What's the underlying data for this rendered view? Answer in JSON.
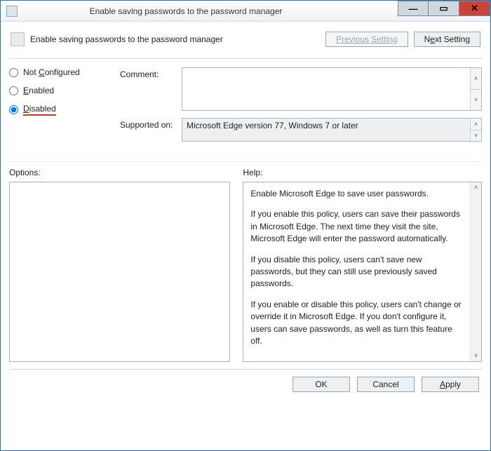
{
  "window": {
    "title": "Enable saving passwords to the password manager"
  },
  "header": {
    "title": "Enable saving passwords to the password manager",
    "prev_btn": "Previous Setting",
    "next_btn_pre": "N",
    "next_btn_u": "e",
    "next_btn_post": "xt Setting"
  },
  "state": {
    "not_configured_pre": "Not ",
    "not_configured_u": "C",
    "not_configured_post": "onfigured",
    "enabled_u": "E",
    "enabled_post": "nabled",
    "disabled_u": "D",
    "disabled_post": "isabled",
    "selected": "disabled"
  },
  "labels": {
    "comment": "Comment:",
    "supported": "Supported on:",
    "options": "Options:",
    "help": "Help:"
  },
  "comment_value": "",
  "supported_on": "Microsoft Edge version 77, Windows 7 or later",
  "help": {
    "p1": "Enable Microsoft Edge to save user passwords.",
    "p2": "If you enable this policy, users can save their passwords in Microsoft Edge. The next time they visit the site, Microsoft Edge will enter the password automatically.",
    "p3": "If you disable this policy, users can't save new passwords, but they can still use previously saved passwords.",
    "p4": "If you enable or disable this policy, users can't change or override it in Microsoft Edge. If you don't configure it, users can save passwords, as well as turn this feature off."
  },
  "footer": {
    "ok": "OK",
    "cancel": "Cancel",
    "apply_u": "A",
    "apply_post": "pply"
  }
}
